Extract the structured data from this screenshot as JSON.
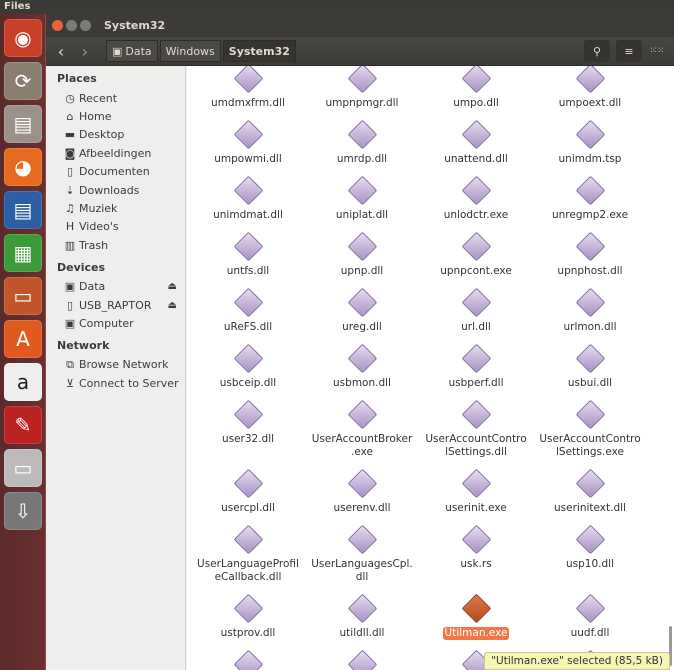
{
  "topbar": {
    "app_name": "Files"
  },
  "window": {
    "title": "System32"
  },
  "toolbar": {
    "back": "‹",
    "forward": "›",
    "breadcrumbs": [
      "Data",
      "Windows",
      "System32"
    ],
    "search_icon": "search-icon",
    "list_icon": "list-view-icon",
    "grid_icon": "grid-view-icon"
  },
  "sidebar": {
    "places_header": "Places",
    "places": [
      {
        "label": "Recent",
        "icon": "◷"
      },
      {
        "label": "Home",
        "icon": "⌂"
      },
      {
        "label": "Desktop",
        "icon": "▬"
      },
      {
        "label": "Afbeeldingen",
        "icon": "◙"
      },
      {
        "label": "Documenten",
        "icon": "▯"
      },
      {
        "label": "Downloads",
        "icon": "⇣"
      },
      {
        "label": "Muziek",
        "icon": "♫"
      },
      {
        "label": "Video's",
        "icon": "H"
      },
      {
        "label": "Trash",
        "icon": "▥"
      }
    ],
    "devices_header": "Devices",
    "devices": [
      {
        "label": "Data",
        "icon": "▣",
        "eject": "⏏"
      },
      {
        "label": "USB_RAPTOR",
        "icon": "▯",
        "eject": "⏏"
      },
      {
        "label": "Computer",
        "icon": "▣"
      }
    ],
    "network_header": "Network",
    "network": [
      {
        "label": "Browse Network",
        "icon": "⧉"
      },
      {
        "label": "Connect to Server",
        "icon": "⊻"
      }
    ]
  },
  "files": [
    "umdmxfrm.dll",
    "umpnpmgr.dll",
    "umpo.dll",
    "umpoext.dll",
    "umpowmi.dll",
    "umrdp.dll",
    "unattend.dll",
    "unimdm.tsp",
    "unimdmat.dll",
    "uniplat.dll",
    "unlodctr.exe",
    "unregmp2.exe",
    "untfs.dll",
    "upnp.dll",
    "upnpcont.exe",
    "upnphost.dll",
    "uReFS.dll",
    "ureg.dll",
    "url.dll",
    "urlmon.dll",
    "usbceip.dll",
    "usbmon.dll",
    "usbperf.dll",
    "usbui.dll",
    "user32.dll",
    "UserAccountBroker.exe",
    "UserAccountControlSettings.dll",
    "UserAccountControlSettings.exe",
    "usercpl.dll",
    "userenv.dll",
    "userinit.exe",
    "userinitext.dll",
    "UserLanguageProfileCallback.dll",
    "UserLanguagesCpl.dll",
    "usk.rs",
    "usp10.dll",
    "ustprov.dll",
    "utildll.dll",
    "Utilman.exe",
    "uudf.dll",
    "",
    "",
    "",
    ""
  ],
  "selected_index": 38,
  "status": "\"Utilman.exe\" selected  (85,5 kB)"
}
